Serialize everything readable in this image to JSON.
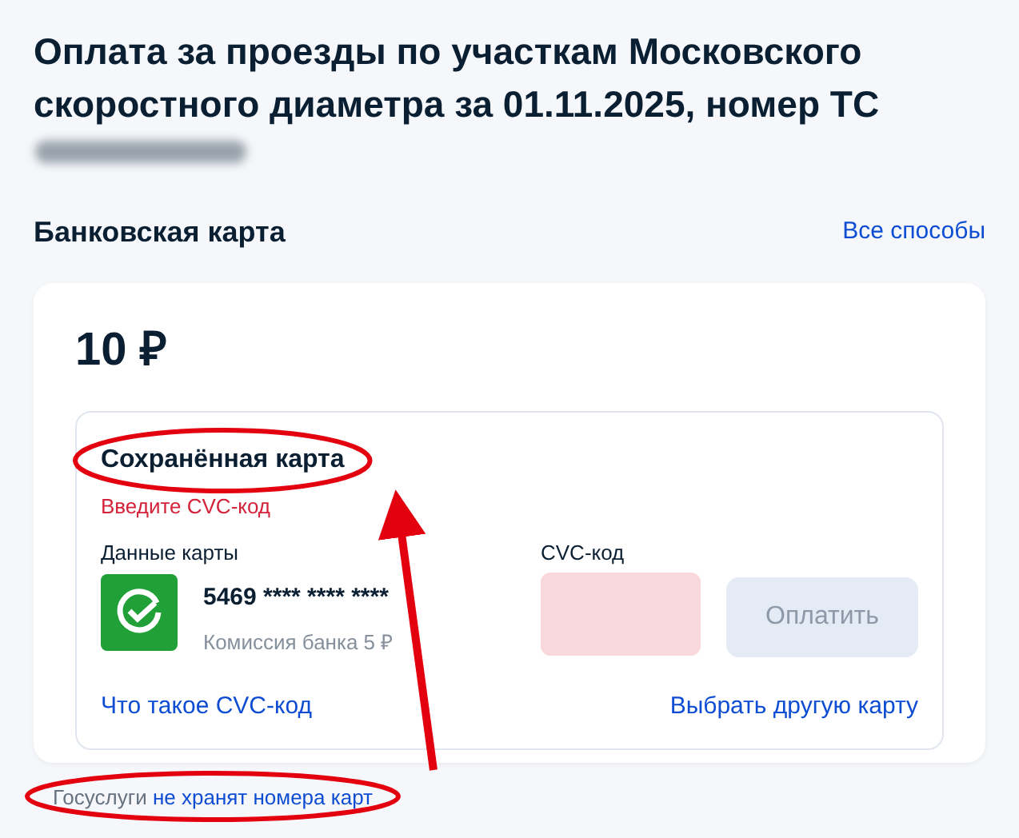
{
  "title": "Оплата за проезды по участкам Московского скоростного диаметра за 01.11.2025, номер ТС",
  "vehicle_number_blurred": true,
  "method": {
    "label": "Банковская карта",
    "link": "Все способы"
  },
  "amount": "10 ₽",
  "saved_card": {
    "title": "Сохранённая карта",
    "error": "Введите CVC-код",
    "card_label": "Данные карты",
    "card_number": "5469 **** **** ****",
    "commission": "Комиссия банка 5 ₽",
    "cvc_label": "CVC-код",
    "cvc_invalid": true,
    "pay_button": {
      "label": "Оплатить",
      "disabled": true
    },
    "help_link": "Что такое CVC-код",
    "other_card_link": "Выбрать другую карту"
  },
  "note": {
    "text": "Госуслуги",
    "link": "не хранят номера карт"
  },
  "annotations": [
    {
      "kind": "ellipse"
    },
    {
      "kind": "ellipse"
    },
    {
      "kind": "arrow"
    }
  ]
}
